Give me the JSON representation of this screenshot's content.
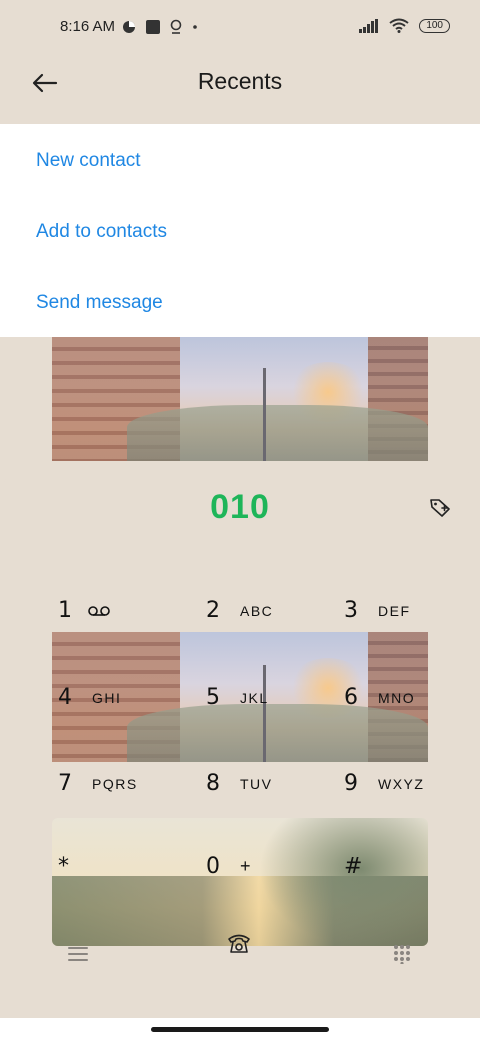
{
  "status_bar": {
    "time": "8:16 AM",
    "battery": "100"
  },
  "header": {
    "title": "Recents"
  },
  "menu": {
    "items": [
      "New contact",
      "Add to contacts",
      "Send message"
    ]
  },
  "dialer": {
    "number": "010",
    "keys": [
      {
        "digit": "1",
        "letters": ""
      },
      {
        "digit": "2",
        "letters": "ABC"
      },
      {
        "digit": "3",
        "letters": "DEF"
      },
      {
        "digit": "4",
        "letters": "GHI"
      },
      {
        "digit": "5",
        "letters": "JKL"
      },
      {
        "digit": "6",
        "letters": "MNO"
      },
      {
        "digit": "7",
        "letters": "PQRS"
      },
      {
        "digit": "8",
        "letters": "TUV"
      },
      {
        "digit": "9",
        "letters": "WXYZ"
      },
      {
        "digit": "*",
        "letters": ""
      },
      {
        "digit": "0",
        "letters": "+"
      },
      {
        "digit": "#",
        "letters": ""
      }
    ]
  },
  "icons": {
    "back": "back-arrow-icon",
    "tag": "tag-plus-icon",
    "voicemail": "voicemail-icon",
    "menu": "menu-lines-icon",
    "call": "phone-call-icon",
    "keypad": "keypad-grid-icon"
  },
  "colors": {
    "accent_link": "#1f87e3",
    "number_green": "#1eb559",
    "background": "#e6ddd2"
  }
}
